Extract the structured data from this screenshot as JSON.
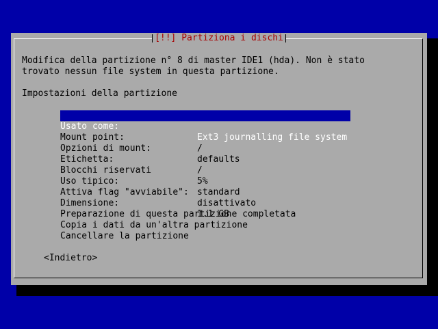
{
  "dialog": {
    "title": "[!!] Partiziona i dischi",
    "description_line1": "Modifica della partizione n° 8 di master IDE1 (hda). Non è stato",
    "description_line2": "trovato nessun file system in questa partizione.",
    "section_heading": "Impostazioni della partizione",
    "settings": [
      {
        "label": "Usato come:",
        "value": "Ext3 journalling file system"
      },
      {
        "label": "Mount point:",
        "value": "/"
      },
      {
        "label": "Opzioni di mount:",
        "value": "defaults"
      },
      {
        "label": "Etichetta:",
        "value": "/"
      },
      {
        "label": "Blocchi riservati",
        "value": "5%"
      },
      {
        "label": "Uso tipico:",
        "value": "standard"
      },
      {
        "label": "Attiva flag \"avviabile\":",
        "value": "disattivato"
      },
      {
        "label": "Dimensione:",
        "value": "1.1 GB"
      }
    ],
    "actions": [
      "Preparazione di questa partizione completata",
      "Copia i dati da un'altra partizione",
      "Cancellare la partizione"
    ],
    "back_button": "<Indietro>"
  },
  "colors": {
    "background": "#0000a8",
    "dialog": "#aaaaaa",
    "title": "#a80000",
    "selection_bg": "#0000a8",
    "selection_fg": "#ffffff"
  }
}
